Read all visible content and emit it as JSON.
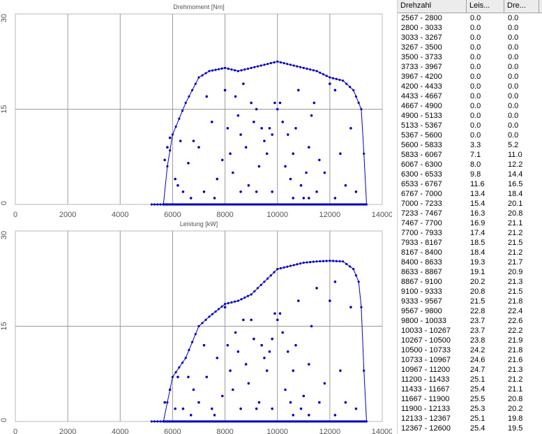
{
  "chart_data": [
    {
      "type": "scatter",
      "title": "Drehmoment [Nm]",
      "xlim": [
        0,
        14000
      ],
      "ylim": [
        0,
        30
      ],
      "xticks": [
        "0",
        "2000",
        "4000",
        "6000",
        "8000",
        "10000",
        "12000",
        "14000"
      ],
      "yticks": [
        "0",
        "15",
        "30"
      ],
      "grid": true,
      "color": "#0000c0",
      "envelope": [
        [
          5200,
          0
        ],
        [
          5650,
          0
        ],
        [
          5800,
          6
        ],
        [
          6000,
          11
        ],
        [
          6500,
          16
        ],
        [
          7000,
          20
        ],
        [
          7400,
          21
        ],
        [
          8000,
          21.5
        ],
        [
          8500,
          21
        ],
        [
          9000,
          21.5
        ],
        [
          9500,
          22
        ],
        [
          10000,
          22.5
        ],
        [
          10500,
          22
        ],
        [
          11000,
          21.5
        ],
        [
          11500,
          21
        ],
        [
          12000,
          20
        ],
        [
          12500,
          19.5
        ],
        [
          12900,
          18
        ],
        [
          13200,
          15
        ],
        [
          13300,
          8
        ],
        [
          13400,
          0
        ]
      ],
      "bottom_line": [
        5200,
        13400
      ],
      "scatter_points": [
        [
          5700,
          7
        ],
        [
          5800,
          9
        ],
        [
          5900,
          10.5
        ],
        [
          6100,
          4
        ],
        [
          6200,
          3
        ],
        [
          6300,
          10
        ],
        [
          6400,
          2
        ],
        [
          6600,
          6.5
        ],
        [
          6800,
          10
        ],
        [
          7000,
          9
        ],
        [
          7200,
          2
        ],
        [
          7300,
          17
        ],
        [
          7500,
          13
        ],
        [
          7700,
          4
        ],
        [
          7900,
          7
        ],
        [
          8000,
          18
        ],
        [
          8100,
          12
        ],
        [
          8200,
          8
        ],
        [
          8300,
          5
        ],
        [
          8400,
          17
        ],
        [
          8500,
          14
        ],
        [
          8600,
          11
        ],
        [
          8700,
          19
        ],
        [
          8800,
          9
        ],
        [
          8900,
          3
        ],
        [
          9000,
          16
        ],
        [
          9100,
          13
        ],
        [
          9200,
          15
        ],
        [
          9300,
          6
        ],
        [
          9400,
          12
        ],
        [
          9500,
          10
        ],
        [
          9600,
          8
        ],
        [
          9700,
          12
        ],
        [
          9800,
          11
        ],
        [
          9900,
          16
        ],
        [
          10000,
          15
        ],
        [
          10100,
          16
        ],
        [
          10200,
          13
        ],
        [
          10300,
          6
        ],
        [
          10400,
          11
        ],
        [
          10500,
          4
        ],
        [
          10600,
          8
        ],
        [
          10700,
          12
        ],
        [
          10800,
          18
        ],
        [
          10900,
          3
        ],
        [
          11000,
          1
        ],
        [
          11100,
          5
        ],
        [
          11200,
          9
        ],
        [
          11300,
          14
        ],
        [
          11400,
          16
        ],
        [
          11500,
          2
        ],
        [
          11600,
          7
        ],
        [
          11800,
          5
        ],
        [
          12000,
          19
        ],
        [
          12200,
          18
        ],
        [
          12400,
          8
        ],
        [
          12600,
          3
        ],
        [
          12800,
          12
        ],
        [
          13000,
          2
        ],
        [
          9200,
          2
        ],
        [
          9800,
          2
        ],
        [
          8600,
          2
        ],
        [
          10600,
          1
        ],
        [
          11200,
          1
        ],
        [
          7600,
          1
        ],
        [
          6700,
          1
        ],
        [
          12200,
          1
        ]
      ]
    },
    {
      "type": "scatter",
      "title": "Leistung [kW]",
      "xlim": [
        0,
        14000
      ],
      "ylim": [
        0,
        30
      ],
      "xticks": [
        "0",
        "2000",
        "4000",
        "6000",
        "8000",
        "10000",
        "12000",
        "14000"
      ],
      "yticks": [
        "0",
        "15",
        "30"
      ],
      "grid": true,
      "color": "#0000c0",
      "envelope": [
        [
          5200,
          0
        ],
        [
          5650,
          0
        ],
        [
          5800,
          3
        ],
        [
          6000,
          7
        ],
        [
          6500,
          10
        ],
        [
          7000,
          15
        ],
        [
          7400,
          16.5
        ],
        [
          8000,
          18.5
        ],
        [
          8500,
          19
        ],
        [
          9000,
          20
        ],
        [
          9500,
          22
        ],
        [
          10000,
          24
        ],
        [
          10500,
          24.5
        ],
        [
          11000,
          25
        ],
        [
          11500,
          25.2
        ],
        [
          12000,
          25.3
        ],
        [
          12500,
          25.2
        ],
        [
          12900,
          24
        ],
        [
          13100,
          22
        ],
        [
          13200,
          18
        ],
        [
          13300,
          8
        ],
        [
          13400,
          0
        ]
      ],
      "bottom_line": [
        5200,
        13400
      ],
      "scatter_points": [
        [
          5700,
          3
        ],
        [
          5900,
          5
        ],
        [
          6100,
          2
        ],
        [
          6200,
          7
        ],
        [
          6400,
          2
        ],
        [
          6600,
          7
        ],
        [
          6800,
          5
        ],
        [
          7000,
          3
        ],
        [
          7200,
          12
        ],
        [
          7300,
          7
        ],
        [
          7500,
          2
        ],
        [
          7700,
          10
        ],
        [
          7900,
          4
        ],
        [
          8000,
          18
        ],
        [
          8100,
          12
        ],
        [
          8200,
          8
        ],
        [
          8300,
          5
        ],
        [
          8400,
          14
        ],
        [
          8500,
          11
        ],
        [
          8700,
          16
        ],
        [
          8800,
          9
        ],
        [
          8900,
          6
        ],
        [
          9000,
          16
        ],
        [
          9100,
          13
        ],
        [
          9300,
          3
        ],
        [
          9400,
          12
        ],
        [
          9500,
          10
        ],
        [
          9600,
          8
        ],
        [
          9700,
          11
        ],
        [
          9800,
          13
        ],
        [
          9900,
          17
        ],
        [
          10000,
          16
        ],
        [
          10100,
          17
        ],
        [
          10200,
          14
        ],
        [
          10300,
          5
        ],
        [
          10400,
          11
        ],
        [
          10500,
          3
        ],
        [
          10600,
          8
        ],
        [
          10700,
          12
        ],
        [
          10800,
          19
        ],
        [
          10900,
          2
        ],
        [
          11000,
          4
        ],
        [
          11200,
          9
        ],
        [
          11300,
          15
        ],
        [
          11500,
          21
        ],
        [
          11600,
          3
        ],
        [
          11800,
          6
        ],
        [
          12000,
          19
        ],
        [
          12200,
          22
        ],
        [
          12400,
          8
        ],
        [
          12600,
          3
        ],
        [
          12800,
          18
        ],
        [
          13000,
          2
        ],
        [
          9200,
          2
        ],
        [
          9800,
          2
        ],
        [
          8600,
          2
        ],
        [
          10600,
          1
        ],
        [
          11200,
          1
        ],
        [
          7600,
          1
        ],
        [
          6700,
          1
        ],
        [
          12200,
          1
        ]
      ]
    }
  ],
  "table": {
    "headers": [
      "Drehzahl",
      "Leis...",
      "Dre..."
    ],
    "rows": [
      [
        "2567 - 2800",
        "0.0",
        "0.0"
      ],
      [
        "2800 - 3033",
        "0.0",
        "0.0"
      ],
      [
        "3033 - 3267",
        "0.0",
        "0.0"
      ],
      [
        "3267 - 3500",
        "0.0",
        "0.0"
      ],
      [
        "3500 - 3733",
        "0.0",
        "0.0"
      ],
      [
        "3733 - 3967",
        "0.0",
        "0.0"
      ],
      [
        "3967 - 4200",
        "0.0",
        "0.0"
      ],
      [
        "4200 - 4433",
        "0.0",
        "0.0"
      ],
      [
        "4433 - 4667",
        "0.0",
        "0.0"
      ],
      [
        "4667 - 4900",
        "0.0",
        "0.0"
      ],
      [
        "4900 - 5133",
        "0.0",
        "0.0"
      ],
      [
        "5133 - 5367",
        "0.0",
        "0.0"
      ],
      [
        "5367 - 5600",
        "0.0",
        "0.0"
      ],
      [
        "5600 - 5833",
        "3.3",
        "5.2"
      ],
      [
        "5833 - 6067",
        "7.1",
        "11.0"
      ],
      [
        "6067 - 6300",
        "8.0",
        "12.2"
      ],
      [
        "6300 - 6533",
        "9.8",
        "14.4"
      ],
      [
        "6533 - 6767",
        "11.6",
        "16.5"
      ],
      [
        "6767 - 7000",
        "13.4",
        "18.4"
      ],
      [
        "7000 - 7233",
        "15.4",
        "20.1"
      ],
      [
        "7233 - 7467",
        "16.3",
        "20.8"
      ],
      [
        "7467 - 7700",
        "16.9",
        "21.1"
      ],
      [
        "7700 - 7933",
        "17.4",
        "21.2"
      ],
      [
        "7933 - 8167",
        "18.5",
        "21.5"
      ],
      [
        "8167 - 8400",
        "18.4",
        "21.2"
      ],
      [
        "8400 - 8633",
        "19.3",
        "21.7"
      ],
      [
        "8633 - 8867",
        "19.1",
        "20.9"
      ],
      [
        "8867 - 9100",
        "20.2",
        "21.3"
      ],
      [
        "9100 - 9333",
        "20.8",
        "21.5"
      ],
      [
        "9333 - 9567",
        "21.5",
        "21.8"
      ],
      [
        "9567 - 9800",
        "22.8",
        "22.4"
      ],
      [
        "9800 - 10033",
        "23.7",
        "22.6"
      ],
      [
        "10033 - 10267",
        "23.7",
        "22.2"
      ],
      [
        "10267 - 10500",
        "23.8",
        "21.9"
      ],
      [
        "10500 - 10733",
        "24.2",
        "21.8"
      ],
      [
        "10733 - 10967",
        "24.6",
        "21.6"
      ],
      [
        "10967 - 11200",
        "24.7",
        "21.3"
      ],
      [
        "11200 - 11433",
        "25.1",
        "21.2"
      ],
      [
        "11433 - 11667",
        "25.4",
        "21.1"
      ],
      [
        "11667 - 11900",
        "25.5",
        "20.8"
      ],
      [
        "11900 - 12133",
        "25.3",
        "20.2"
      ],
      [
        "12133 - 12367",
        "25.1",
        "19.8"
      ],
      [
        "12367 - 12600",
        "25.4",
        "19.5"
      ]
    ]
  }
}
